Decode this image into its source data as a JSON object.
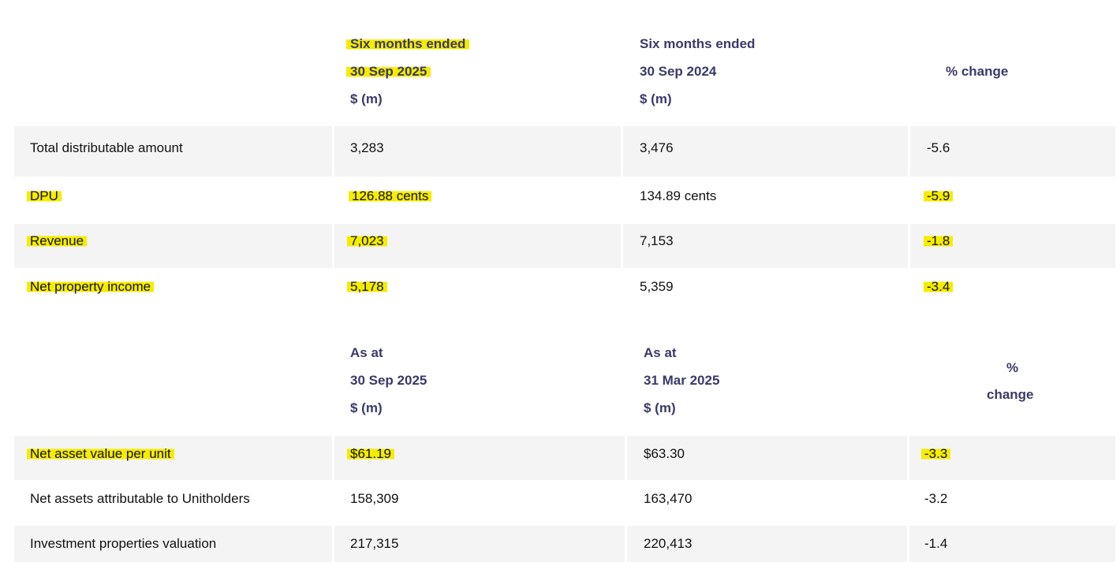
{
  "table1": {
    "headers": {
      "col1": [
        "Six months ended",
        "30 Sep 2025",
        "$ (m)"
      ],
      "col2": [
        "Six months ended",
        "30 Sep 2024",
        "$ (m)"
      ],
      "col3": "% change"
    },
    "rows": [
      {
        "label": "Total distributable amount",
        "current": "3,283",
        "prior": "3,476",
        "change": "-5.6"
      },
      {
        "label": "DPU",
        "current": "126.88 cents",
        "prior": "134.89 cents",
        "change": "-5.9"
      },
      {
        "label": "Revenue",
        "current": "7,023",
        "prior": "7,153",
        "change": "-1.8"
      },
      {
        "label": "Net property income",
        "current": "5,178",
        "prior": "5,359",
        "change": "-3.4"
      }
    ]
  },
  "table2": {
    "headers": {
      "col1": [
        "As at",
        "30 Sep 2025",
        "$ (m)"
      ],
      "col2": [
        "As at",
        "31 Mar 2025",
        "$ (m)"
      ],
      "col3": [
        "%",
        "change"
      ]
    },
    "rows": [
      {
        "label": "Net asset value per unit",
        "current": "$61.19",
        "prior": "$63.30",
        "change": "-3.3"
      },
      {
        "label": "Net assets attributable to Unitholders",
        "current": "158,309",
        "prior": "163,470",
        "change": "-3.2"
      },
      {
        "label": "Investment properties valuation",
        "current": "217,315",
        "prior": "220,413",
        "change": "-1.4"
      }
    ]
  },
  "colors": {
    "header_text": "#3a3a6a",
    "row_shade": "#f4f4f4",
    "highlight": "#f5ec00"
  }
}
